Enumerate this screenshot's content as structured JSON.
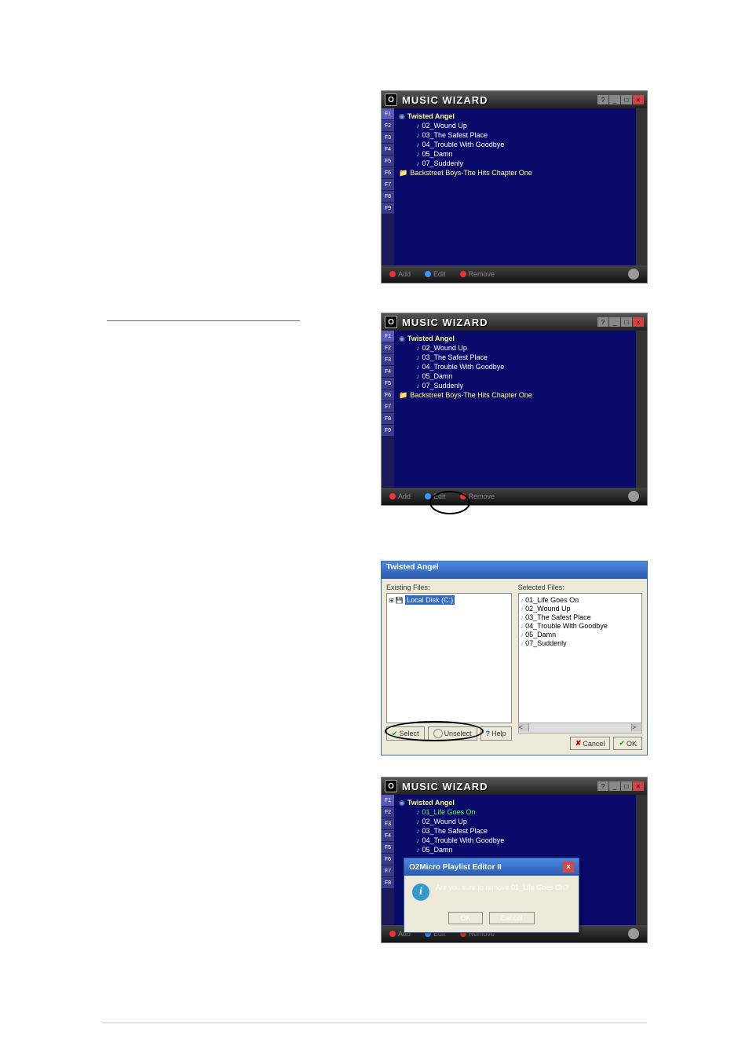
{
  "musicWizard": {
    "logo": "O",
    "title": "MUSIC WIZARD",
    "winHelp": "?",
    "winMin": "_",
    "winMax": "□",
    "winClose": "×",
    "sidebarTabs": [
      "F1",
      "F2",
      "F3",
      "F4",
      "F5",
      "F6",
      "F7",
      "F8",
      "F9"
    ],
    "album1": "Twisted Angel",
    "tracks1": [
      "02_Wound Up",
      "03_The Safest Place",
      "04_Trouble With Goodbye",
      "05_Damn",
      "07_Suddenly"
    ],
    "album2": "Backstreet Boys-The Hits Chapter One",
    "footer": {
      "add": "Add",
      "edit": "Edit",
      "remove": "Remove"
    }
  },
  "editDialog": {
    "title": "Twisted Angel",
    "existingLabel": "Existing Files:",
    "selectedLabel": "Selected Files:",
    "drive": "Local Disk (C:)",
    "selected": [
      "01_Life Goes On",
      "02_Wound Up",
      "03_The Safest Place",
      "04_Trouble With Goodbye",
      "05_Damn",
      "07_Suddenly"
    ],
    "scrollL": "<",
    "scrollR": ">",
    "btnSelect": "Select",
    "btnUnselect": "Unselect",
    "btnHelp": "Help",
    "btnCancel": "Cancel",
    "btnOK": "OK"
  },
  "fig4": {
    "album": "Twisted Angel",
    "tracks": [
      "01_Life Goes On",
      "02_Wound Up",
      "03_The Safest Place",
      "04_Trouble With Goodbye",
      "05_Damn"
    ],
    "popupTitle": "O2Micro Playlist Editor II",
    "popupMsg": "Are you sure to remove 01_Life Goes On?",
    "btnOK": "OK",
    "btnCancel": "Cancel"
  }
}
